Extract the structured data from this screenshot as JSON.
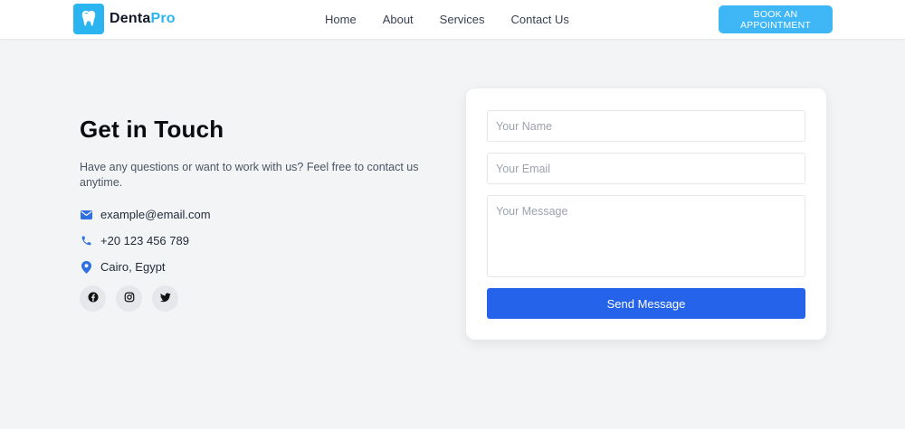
{
  "header": {
    "brand_part1": "Denta",
    "brand_part2": "Pro",
    "nav": [
      {
        "label": "Home"
      },
      {
        "label": "About"
      },
      {
        "label": "Services"
      },
      {
        "label": "Contact Us"
      }
    ],
    "cta_label": "BOOK AN APPOINTMENT"
  },
  "contact": {
    "heading": "Get in Touch",
    "intro": "Have any questions or want to work with us? Feel free to contact us anytime.",
    "email": "example@email.com",
    "phone": "+20 123 456 789",
    "location": "Cairo, Egypt",
    "socials": [
      {
        "icon": "facebook-icon"
      },
      {
        "icon": "instagram-icon"
      },
      {
        "icon": "twitter-icon"
      }
    ]
  },
  "form": {
    "name_placeholder": "Your Name",
    "email_placeholder": "Your Email",
    "message_placeholder": "Your Message",
    "submit_label": "Send Message"
  },
  "colors": {
    "brand": "#2bb5f0",
    "cta": "#3fb6f6",
    "primary": "#2563eb",
    "icon_blue": "#2f6fe0",
    "background": "#f3f4f6"
  }
}
